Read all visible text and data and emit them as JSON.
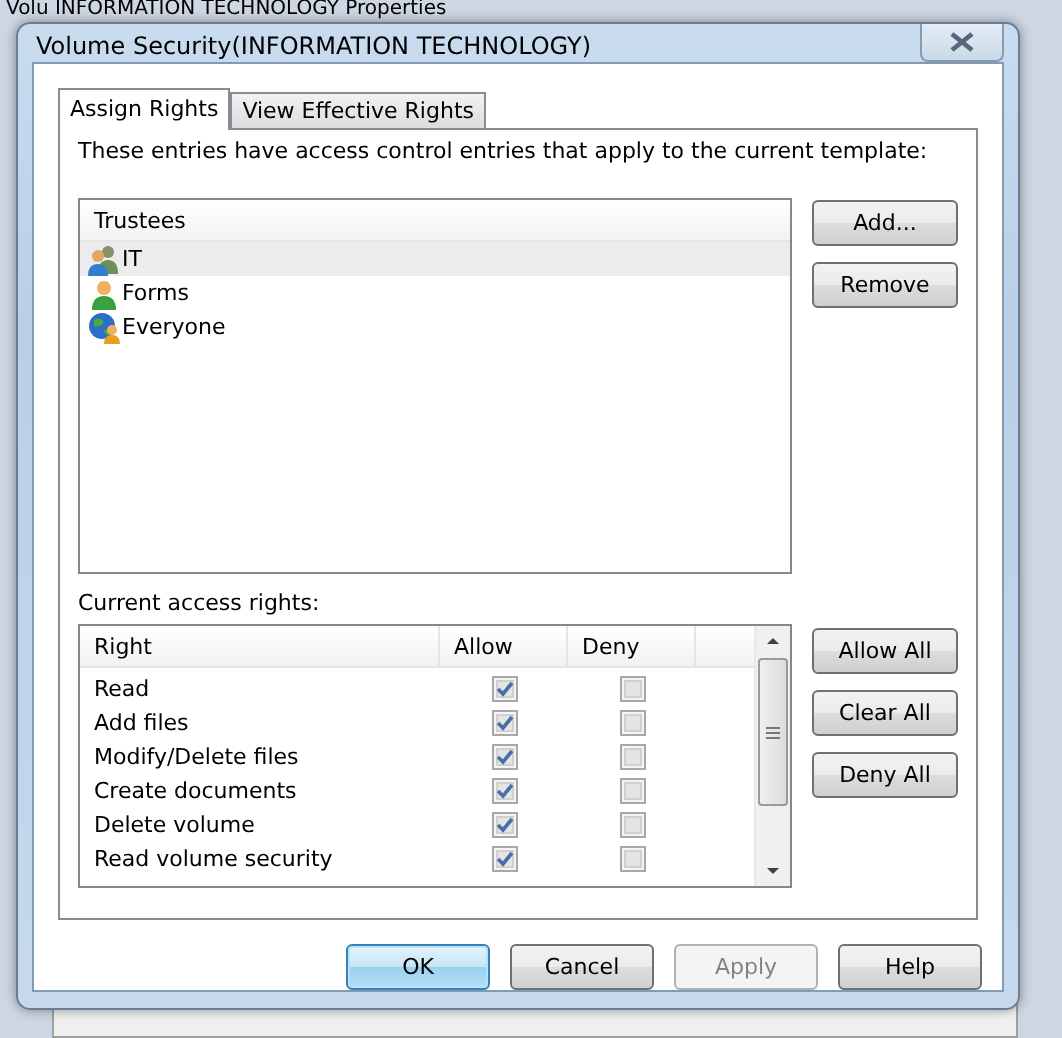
{
  "background_window": {
    "title": "Volu  INFORMATION TECHNOLOGY Properties"
  },
  "window": {
    "title": "Volume Security(INFORMATION TECHNOLOGY)"
  },
  "tabs": [
    {
      "label": "Assign Rights",
      "selected": true
    },
    {
      "label": "View Effective Rights",
      "selected": false
    }
  ],
  "description": "These entries have access control entries that apply to the current template:",
  "trustees": {
    "column": "Trustees",
    "items": [
      {
        "name": "IT",
        "kind": "group",
        "selected": true
      },
      {
        "name": "Forms",
        "kind": "user",
        "selected": false
      },
      {
        "name": "Everyone",
        "kind": "everyone",
        "selected": false
      }
    ]
  },
  "trustee_buttons": [
    {
      "label": "Add..."
    },
    {
      "label": "Remove"
    }
  ],
  "rights_label": "Current access rights:",
  "rights": {
    "columns": [
      "Right",
      "Allow",
      "Deny"
    ],
    "rows": [
      {
        "name": "Read",
        "allow": true,
        "deny": false
      },
      {
        "name": "Add files",
        "allow": true,
        "deny": false
      },
      {
        "name": "Modify/Delete files",
        "allow": true,
        "deny": false
      },
      {
        "name": "Create documents",
        "allow": true,
        "deny": false
      },
      {
        "name": "Delete volume",
        "allow": true,
        "deny": false
      },
      {
        "name": "Read volume security",
        "allow": true,
        "deny": false
      }
    ]
  },
  "rights_buttons": [
    {
      "label": "Allow All"
    },
    {
      "label": "Clear All"
    },
    {
      "label": "Deny All"
    }
  ],
  "dialog_buttons": [
    {
      "label": "OK",
      "default": true,
      "disabled": false
    },
    {
      "label": "Cancel",
      "default": false,
      "disabled": false
    },
    {
      "label": "Apply",
      "default": false,
      "disabled": true
    },
    {
      "label": "Help",
      "default": false,
      "disabled": false
    }
  ]
}
